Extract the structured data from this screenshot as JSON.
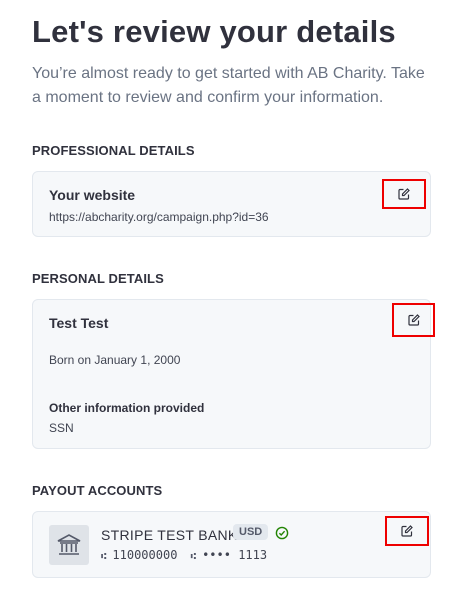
{
  "header": {
    "title": "Let's review your details",
    "intro": "You’re almost ready to get started with AB Charity. Take a moment to review and confirm your information."
  },
  "professional": {
    "heading": "PROFESSIONAL DETAILS",
    "website_label": "Your website",
    "website_value": "https://abcharity.org/campaign.php?id=36"
  },
  "personal": {
    "heading": "PERSONAL DETAILS",
    "name": "Test Test",
    "born": "Born on January 1, 2000",
    "other_label": "Other information provided",
    "other_value": "SSN"
  },
  "payout": {
    "heading": "PAYOUT ACCOUNTS",
    "bank_name": "STRIPE TEST BANK",
    "currency": "USD",
    "routing_symbol": "⑆",
    "routing": "110000000",
    "account_symbol": "⑆",
    "account_masked": "•••• 1113"
  },
  "icons": {
    "edit": "edit-icon",
    "bank": "bank-icon",
    "verified": "check-circle-icon"
  },
  "colors": {
    "highlight_border": "#ee0000",
    "card_bg": "#f6f8fa",
    "verified_green": "#228403"
  }
}
